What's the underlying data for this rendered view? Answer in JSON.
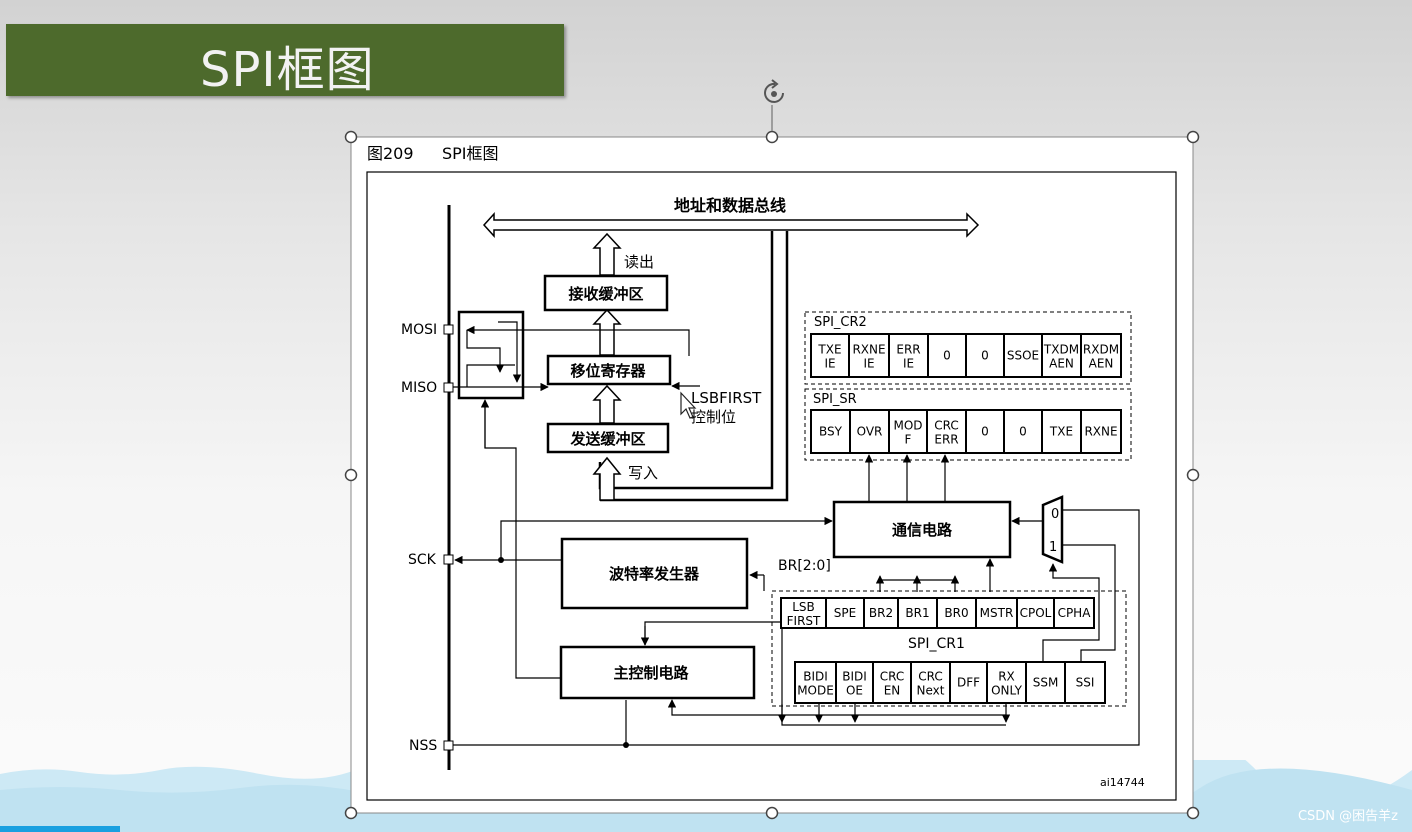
{
  "slide": {
    "title": "SPI框图",
    "watermark": "CSDN @困告羊z"
  },
  "figure": {
    "caption_number": "图209",
    "caption_title": "SPI框图",
    "ref_id": "ai14744"
  },
  "bus_label": "地址和数据总线",
  "labels": {
    "read": "读出",
    "write": "写入",
    "lsbfirst": "LSBFIRST",
    "control_bit": "控制位",
    "br": "BR[2:0]"
  },
  "blocks": {
    "rx_buffer": "接收缓冲区",
    "shift_register": "移位寄存器",
    "tx_buffer": "发送缓冲区",
    "comm_circuit": "通信电路",
    "baud_gen": "波特率发生器",
    "master_ctrl": "主控制电路"
  },
  "pins": {
    "mosi": "MOSI",
    "miso": "MISO",
    "sck": "SCK",
    "nss": "NSS"
  },
  "mux": {
    "in0": "0",
    "in1": "1"
  },
  "registers": {
    "cr2": {
      "name": "SPI_CR2",
      "bits": [
        [
          "TXE",
          "IE"
        ],
        [
          "RXNE",
          "IE"
        ],
        [
          "ERR",
          "IE"
        ],
        [
          "0"
        ],
        [
          "0"
        ],
        [
          "SSOE"
        ],
        [
          "TXDM",
          "AEN"
        ],
        [
          "RXDM",
          "AEN"
        ]
      ]
    },
    "sr": {
      "name": "SPI_SR",
      "bits": [
        [
          "BSY"
        ],
        [
          "OVR"
        ],
        [
          "MOD",
          "F"
        ],
        [
          "CRC",
          "ERR"
        ],
        [
          "0"
        ],
        [
          "0"
        ],
        [
          "TXE"
        ],
        [
          "RXNE"
        ]
      ]
    },
    "cr1": {
      "name": "SPI_CR1",
      "top_bits": [
        [
          "LSB",
          "FIRST"
        ],
        [
          "SPE"
        ],
        [
          "BR2"
        ],
        [
          "BR1"
        ],
        [
          "BR0"
        ],
        [
          "MSTR"
        ],
        [
          "CPOL"
        ],
        [
          "CPHA"
        ]
      ],
      "bottom_bits": [
        [
          "BIDI",
          "MODE"
        ],
        [
          "BIDI",
          "OE"
        ],
        [
          "CRC",
          "EN"
        ],
        [
          "CRC",
          "Next"
        ],
        [
          "DFF"
        ],
        [
          "RX",
          "ONLY"
        ],
        [
          "SSM"
        ],
        [
          "SSI"
        ]
      ]
    }
  },
  "colors": {
    "title_bar": "#4d6a2c",
    "accent_blue": "#1aa0e0",
    "wave": "#cde9f5"
  }
}
